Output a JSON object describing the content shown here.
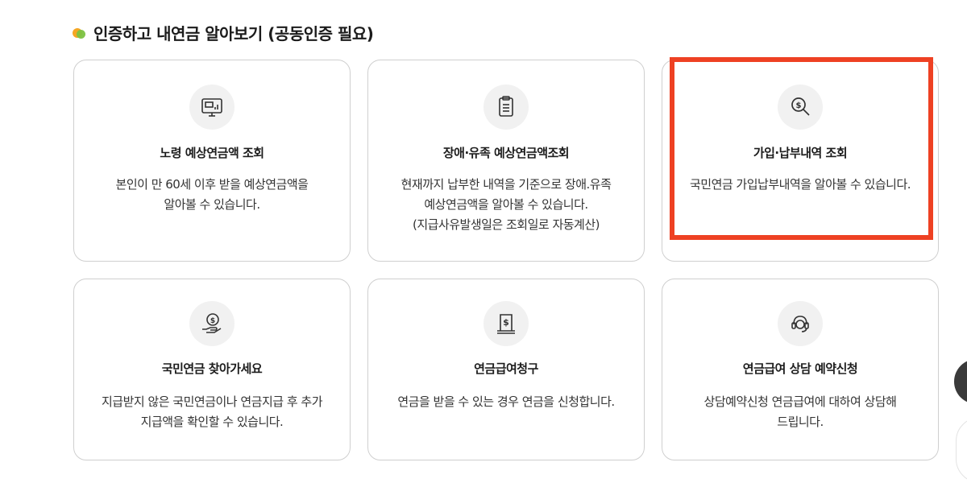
{
  "section": {
    "title": "인증하고 내연금 알아보기 (공동인증 필요)",
    "dot_colors": [
      "#f5a623",
      "#7cc242"
    ]
  },
  "cards": [
    {
      "icon": "monitor-chart-icon",
      "title": "노령 예상연금액 조회",
      "desc": "본인이 만 60세 이후 받을 예상연금액을\n알아볼 수 있습니다."
    },
    {
      "icon": "document-list-icon",
      "title": "장애·유족 예상연금액조회",
      "desc": "현재까지 납부한 내역을 기준으로 장애.유족\n예상연금액을 알아볼 수 있습니다.\n(지급사유발생일은 조회일로 자동계산)"
    },
    {
      "icon": "dollar-magnifier-icon",
      "title": "가입·납부내역 조회",
      "desc": "국민연금 가입납부내역을 알아볼 수 있습니다."
    },
    {
      "icon": "hand-coin-icon",
      "title": "국민연금 찾아가세요",
      "desc": "지급받지 않은 국민연금이나 연금지급 후 추가\n지급액을 확인할 수 있습니다."
    },
    {
      "icon": "dollar-document-icon",
      "title": "연금급여청구",
      "desc": "연금을 받을 수 있는 경우 연금을 신청합니다."
    },
    {
      "icon": "headset-counselor-icon",
      "title": "연금급여 상담 예약신청",
      "desc": "상담예약신청 연금급여에 대하여 상담해\n드립니다."
    }
  ],
  "highlight_color": "#ee4123"
}
